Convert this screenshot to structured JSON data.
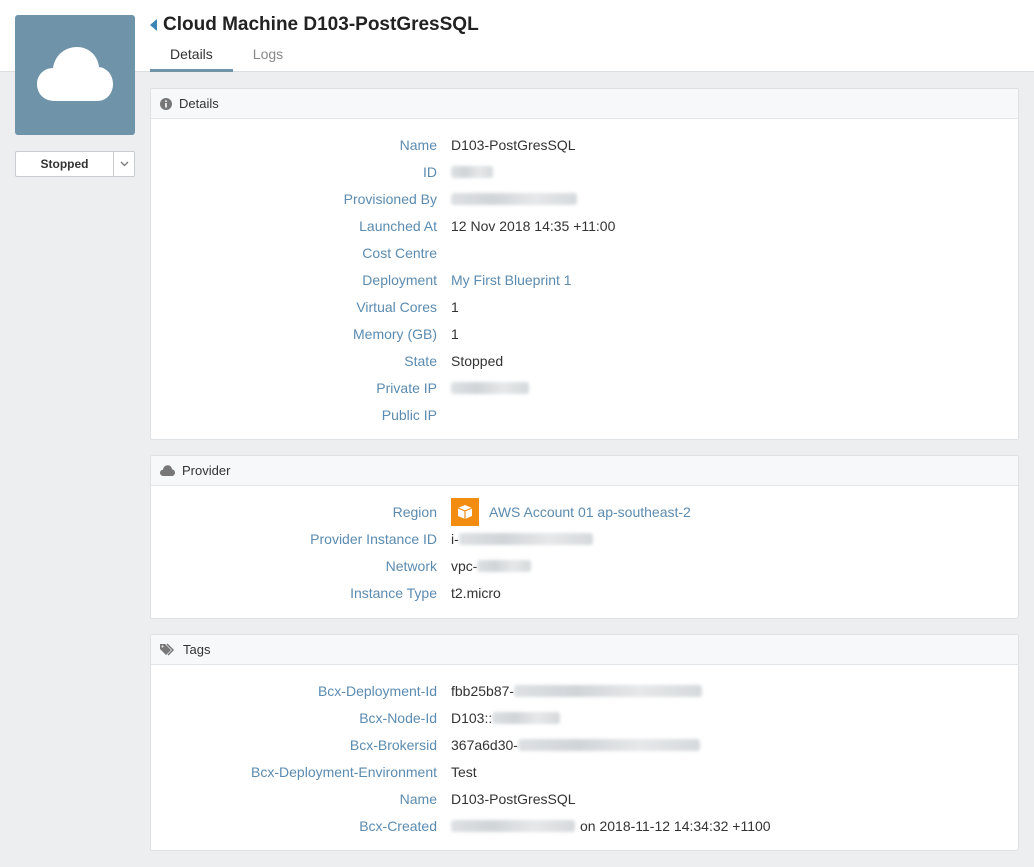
{
  "header": {
    "title": "Cloud Machine D103-PostGresSQL",
    "tabs": [
      {
        "label": "Details"
      },
      {
        "label": "Logs"
      }
    ],
    "state_button": "Stopped"
  },
  "details": {
    "title": "Details",
    "rows": [
      {
        "label": "Name",
        "value": "D103-PostGresSQL"
      },
      {
        "label": "ID",
        "value": ""
      },
      {
        "label": "Provisioned By",
        "value": ""
      },
      {
        "label": "Launched At",
        "value": "12 Nov 2018 14:35 +11:00"
      },
      {
        "label": "Cost Centre",
        "value": ""
      },
      {
        "label": "Deployment",
        "value": "My First Blueprint 1"
      },
      {
        "label": "Virtual Cores",
        "value": "1"
      },
      {
        "label": "Memory (GB)",
        "value": "1"
      },
      {
        "label": "State",
        "value": "Stopped"
      },
      {
        "label": "Private IP",
        "value": ""
      },
      {
        "label": "Public IP",
        "value": ""
      }
    ]
  },
  "provider": {
    "title": "Provider",
    "rows": [
      {
        "label": "Region",
        "value": "AWS Account 01 ap-southeast-2"
      },
      {
        "label": "Provider Instance ID",
        "value": "i-"
      },
      {
        "label": "Network",
        "value": "vpc-"
      },
      {
        "label": "Instance Type",
        "value": "t2.micro"
      }
    ]
  },
  "tags": {
    "title": "Tags",
    "rows": [
      {
        "label": "Bcx-Deployment-Id",
        "value": "fbb25b87-"
      },
      {
        "label": "Bcx-Node-Id",
        "value": "D103::"
      },
      {
        "label": "Bcx-Brokersid",
        "value": "367a6d30-"
      },
      {
        "label": "Bcx-Deployment-Environment",
        "value": "Test"
      },
      {
        "label": "Name",
        "value": "D103-PostGresSQL"
      },
      {
        "label": "Bcx-Created",
        "value": "on 2018-11-12 14:34:32 +1100"
      }
    ]
  },
  "icons": {
    "thumbnail": "cloud-icon",
    "details": "info-icon",
    "provider": "cloud-icon",
    "tags": "tags-icon",
    "region": "aws-box-icon",
    "back": "back-arrow-icon",
    "dropdown": "chevron-down-icon"
  },
  "colors": {
    "accent": "#5b8bb0",
    "thumbnail_bg": "#6f93a8",
    "aws": "#f28d12"
  }
}
